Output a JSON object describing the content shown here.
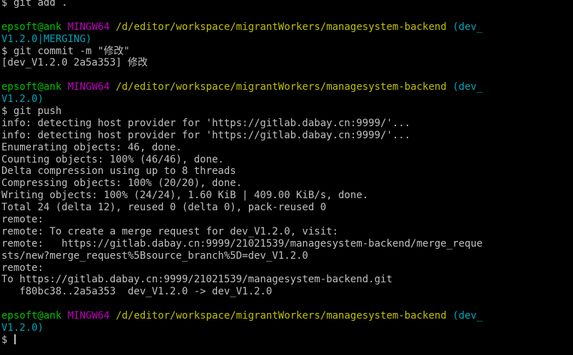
{
  "prompt": {
    "user": "epsoft@ank",
    "env": "MINGW64",
    "path": "/d/editor/workspace/migrantWorkers/managesystem-backend",
    "branch_open_1": "(dev_",
    "branch_close_1": "V1.2.0|MERGING)",
    "branch_open_2": "(dev_",
    "branch_close_2": "V1.2.0)",
    "branch_open_3": "(dev_",
    "branch_close_3": "V1.2.0)",
    "symbol": "$"
  },
  "lines": {
    "l0": "$ git add .",
    "l3": "$ git commit -m \"修改\"",
    "l4": "[dev_V1.2.0 2a5a353] 修改",
    "l8": "$ git push",
    "l9": "info: detecting host provider for 'https://gitlab.dabay.cn:9999/'...",
    "l10": "info: detecting host provider for 'https://gitlab.dabay.cn:9999/'...",
    "l11": "Enumerating objects: 46, done.",
    "l12": "Counting objects: 100% (46/46), done.",
    "l13": "Delta compression using up to 8 threads",
    "l14": "Compressing objects: 100% (20/20), done.",
    "l15": "Writing objects: 100% (24/24), 1.60 KiB | 409.00 KiB/s, done.",
    "l16": "Total 24 (delta 12), reused 0 (delta 0), pack-reused 0",
    "l17": "remote:",
    "l18": "remote: To create a merge request for dev_V1.2.0, visit:",
    "l19": "remote:   https://gitlab.dabay.cn:9999/21021539/managesystem-backend/merge_reque",
    "l20": "sts/new?merge_request%5Bsource_branch%5D=dev_V1.2.0",
    "l21": "remote:",
    "l22": "To https://gitlab.dabay.cn:9999/21021539/managesystem-backend.git",
    "l23": "   f80bc38..2a5a353  dev_V1.2.0 -> dev_V1.2.0"
  },
  "colors": {
    "background": "#000000",
    "text": "#c0c0c0",
    "user": "#00c000",
    "env": "#c000c0",
    "path": "#c0c000",
    "branch": "#00a6b8"
  }
}
